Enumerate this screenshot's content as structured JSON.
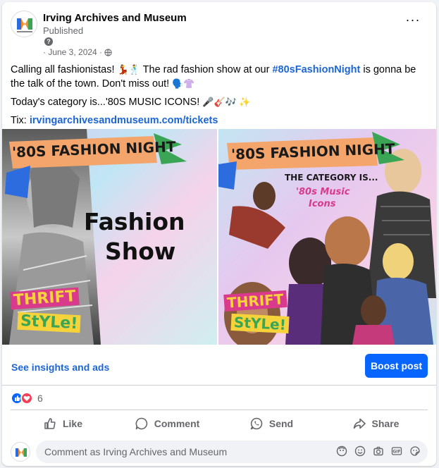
{
  "post": {
    "page_name": "Irving Archives and Museum",
    "status": "Published",
    "date": "· June 3, 2024 ·",
    "more_label": "···",
    "line1_a": "Calling all fashionistas! ",
    "line1_emoji": "💃🕺",
    "line1_b": " The rad fashion show at our ",
    "hashtag": "#80sFashionNight",
    "line1_c": " is gonna be the talk of the town. Don't miss out! ",
    "line1_emoji2": "🗣️👚",
    "line2": "Today's category is...'80S MUSIC ICONS! ",
    "line2_emoji": "🎤🎸🎶 ✨",
    "tix_label": "Tix: ",
    "tix_link": "irvingarchivesandmuseum.com/tickets"
  },
  "images": {
    "left": {
      "banner": "'80S FASHION NIGHT",
      "title_line1": "Fashion",
      "title_line2": "Show",
      "thrift1": "THRIFT",
      "thrift2": "StYLe!"
    },
    "right": {
      "banner": "'80S FASHION NIGHT",
      "subtitle": "THE CATEGORY IS...",
      "category_line1": "'80s Music",
      "category_line2": "Icons",
      "thrift1": "THRIFT",
      "thrift2": "StYLe!"
    }
  },
  "insights": {
    "link_label": "See insights and ads",
    "boost_label": "Boost post"
  },
  "reactions": {
    "count": "6"
  },
  "actions": {
    "like": "Like",
    "comment": "Comment",
    "send": "Send",
    "share": "Share"
  },
  "comment": {
    "placeholder": "Comment as Irving Archives and Museum",
    "tools": [
      "avatar-sticker-icon",
      "emoji-icon",
      "camera-icon",
      "gif-icon",
      "sticker-icon"
    ]
  },
  "colors": {
    "primary": "#0866ff",
    "link": "#1b65d6",
    "secondary_text": "#65676b"
  }
}
